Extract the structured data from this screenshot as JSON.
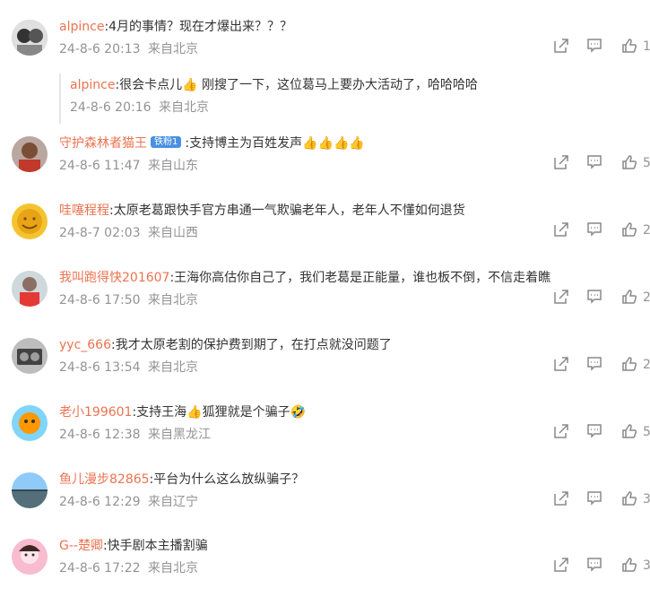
{
  "comments": [
    {
      "name": "alpince",
      "text": ":4月的事情？现在才爆出来？？？",
      "time": "24-8-6 20:13",
      "location": "来自北京",
      "likes": "1",
      "reply": {
        "name": "alpince",
        "text": ":很会卡点儿👍 刚搜了一下，这位葛马上要办大活动了，哈哈哈哈",
        "time": "24-8-6 20:16",
        "location": "来自北京"
      }
    },
    {
      "name": "守护森林者猫王",
      "badge": "铁粉1",
      "text": ":支持博主为百姓发声👍👍👍👍",
      "time": "24-8-6 11:47",
      "location": "来自山东",
      "likes": "5"
    },
    {
      "name": "哇噻程程",
      "text": ":太原老葛跟快手官方串通一气欺骗老年人，老年人不懂如何退货",
      "time": "24-8-7 02:03",
      "location": "来自山西",
      "likes": "2"
    },
    {
      "name": "我叫跑得快201607",
      "text": ":王海你高估你自己了，我们老葛是正能量，谁也板不倒，不信走着瞧",
      "time": "24-8-6 17:50",
      "location": "来自北京",
      "likes": "2"
    },
    {
      "name": "yyc_666",
      "text": ":我才太原老割的保护费到期了，在打点就没问题了",
      "time": "24-8-6 13:54",
      "location": "来自北京",
      "likes": "2"
    },
    {
      "name": "老小199601",
      "text": ":支持王海👍狐狸就是个骗子🤣",
      "time": "24-8-6 12:38",
      "location": "来自黑龙江",
      "likes": "5"
    },
    {
      "name": "鱼儿漫步82865",
      "text": ":平台为什么这么放纵骗子？",
      "time": "24-8-6 12:29",
      "location": "来自辽宁",
      "likes": "3"
    },
    {
      "name": "G--楚卿",
      "text": ":快手剧本主播割骗",
      "time": "24-8-6 17:22",
      "location": "来自北京",
      "likes": "3"
    }
  ],
  "icons": {
    "share": "share-icon",
    "comment": "comment-icon",
    "like": "thumbs-up-icon"
  },
  "colors": {
    "name": "#eb7350",
    "meta": "#939393",
    "badge": "#4a90e2"
  }
}
